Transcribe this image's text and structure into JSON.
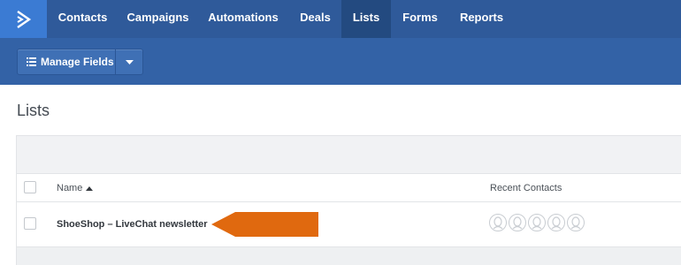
{
  "nav": {
    "items": [
      {
        "label": "Contacts"
      },
      {
        "label": "Campaigns"
      },
      {
        "label": "Automations"
      },
      {
        "label": "Deals"
      },
      {
        "label": "Lists",
        "active": true
      },
      {
        "label": "Forms"
      },
      {
        "label": "Reports"
      }
    ]
  },
  "toolbar": {
    "manage_fields_label": "Manage Fields"
  },
  "page": {
    "title": "Lists"
  },
  "table": {
    "columns": {
      "name": "Name",
      "recent_contacts": "Recent Contacts"
    },
    "rows": [
      {
        "name": "ShoeShop – LiveChat newsletter",
        "recent_contacts_count": 5
      }
    ]
  },
  "colors": {
    "nav_bg": "#2f5a9a",
    "nav_active": "#234a80",
    "logo_bg": "#3b7bd3",
    "toolbar_bg": "#3362a6",
    "arrow": "#e0690f"
  }
}
